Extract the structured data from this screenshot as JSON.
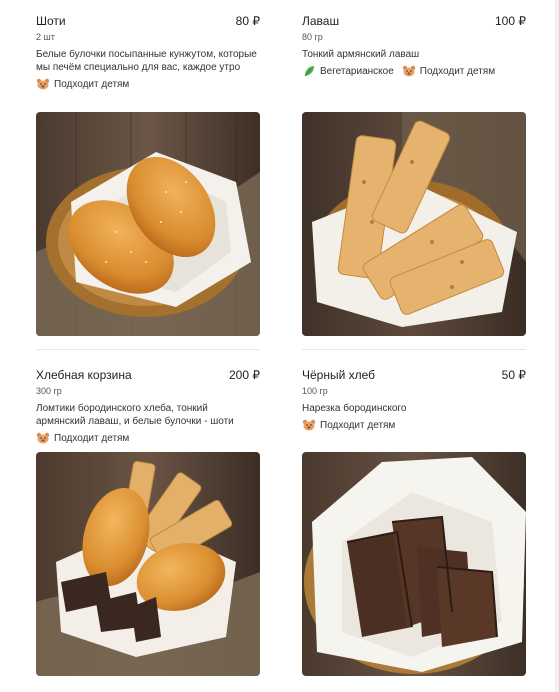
{
  "items": [
    {
      "name": "Шоти",
      "price": "80 ₽",
      "weight": "2 шт",
      "description": "Белые булочки посыпанные кунжутом, которые мы печём специально для вас, каждое утро",
      "tags": [
        "Подходит детям"
      ],
      "image": "bread-rolls-basket"
    },
    {
      "name": "Лаваш",
      "price": "100 ₽",
      "weight": "80 гр",
      "description": "Тонкий армянский лаваш",
      "tags": [
        "Вегетарианское",
        "Подходит детям"
      ],
      "image": "lavash-basket"
    },
    {
      "name": "Хлебная корзина",
      "price": "200 ₽",
      "weight": "300 гр",
      "description": "Ломтики бородинского хлеба, тонкий армянский лаваш, и белые булочки - шоти",
      "tags": [
        "Подходит детям"
      ],
      "image": "mixed-bread-basket"
    },
    {
      "name": "Чёрный хлеб",
      "price": "50 ₽",
      "weight": "100 гр",
      "description": "Нарезка бородинского",
      "tags": [
        "Подходит детям"
      ],
      "image": "rye-bread-basket"
    }
  ],
  "colors": {
    "veg_leaf": "#4caf50",
    "kids_icon": "#d98b4a"
  }
}
